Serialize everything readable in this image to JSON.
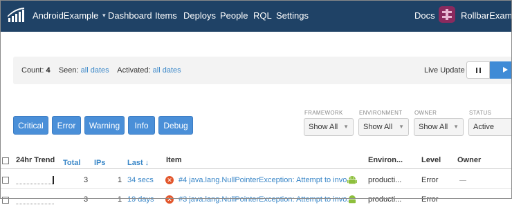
{
  "nav": {
    "project": "AndroidExample",
    "items": [
      "Dashboard",
      "Items",
      "Deploys",
      "People",
      "RQL",
      "Settings"
    ],
    "docs": "Docs",
    "account": "RollbarExample"
  },
  "summary": {
    "count_label": "Count:",
    "count_value": "4",
    "seen_label": "Seen:",
    "seen_value": "all dates",
    "activated_label": "Activated:",
    "activated_value": "all dates",
    "live_update": "Live Update"
  },
  "levels": [
    "Critical",
    "Error",
    "Warning",
    "Info",
    "Debug"
  ],
  "filters": [
    {
      "label": "FRAMEWORK",
      "value": "Show All"
    },
    {
      "label": "ENVIRONMENT",
      "value": "Show All"
    },
    {
      "label": "OWNER",
      "value": "Show All"
    },
    {
      "label": "STATUS",
      "value": "Active"
    }
  ],
  "table": {
    "headers": {
      "trend": "24hr Trend",
      "total": "Total",
      "ips": "IPs",
      "last": "Last ↓",
      "item": "Item",
      "environment": "Environ...",
      "level": "Level",
      "owner": "Owner"
    },
    "rows": [
      {
        "total": "3",
        "ips": "1",
        "last": "34 secs",
        "item": "#4 java.lang.NullPointerException: Attempt to invo...",
        "environment": "producti...",
        "level": "Error",
        "trend_fraction": 1.0
      },
      {
        "total": "3",
        "ips": "1",
        "last": "19 days",
        "item": "#3 java.lang.NullPointerException: Attempt to invo...",
        "environment": "producti...",
        "level": "Error",
        "trend_fraction": 0.0
      }
    ]
  },
  "colors": {
    "navbar": "#1f4266",
    "primary_button": "#4a8fd8",
    "link": "#3a87c8",
    "error_icon": "#e2552a",
    "android_green": "#8dbf3c"
  }
}
